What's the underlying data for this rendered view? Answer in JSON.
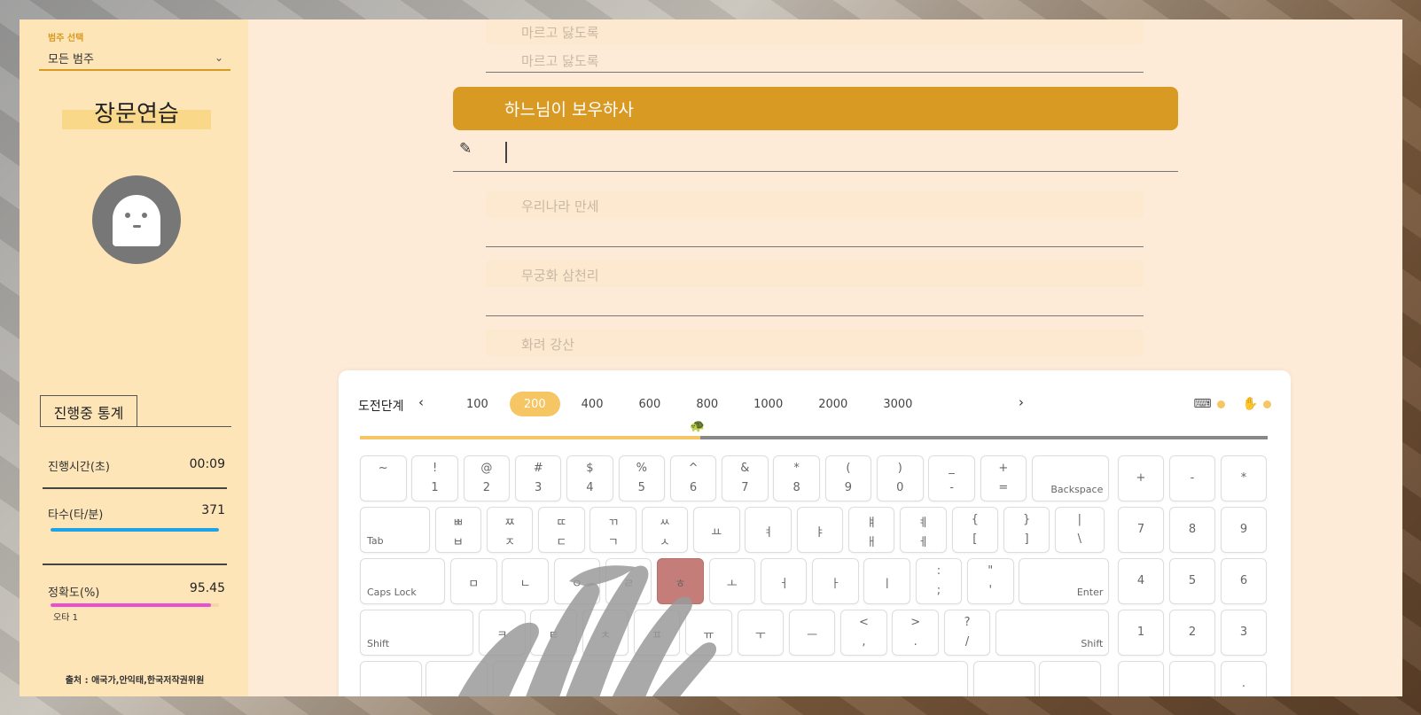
{
  "sidebar": {
    "category_label": "범주 선택",
    "category_value": "모든 범주",
    "mode_title": "장문연습",
    "stats_tab": "진행중 통계",
    "stats": {
      "time_label": "진행시간(초)",
      "time_value": "00:09",
      "speed_label": "타수(타/분)",
      "speed_value": "371",
      "accuracy_label": "정확도(%)",
      "accuracy_value": "95.45",
      "typo_label": "오타 1"
    },
    "source": "출처 : 애국가,안익태,한국저작권위원"
  },
  "colors": {
    "accent": "#d99a24",
    "level_active": "#f6c564",
    "speed_bar": "#1ea2e8",
    "accuracy_bar": "#e94fcf",
    "hit_key": "#c47d78"
  },
  "practice": {
    "prev_line_1": "마르고 닳도록",
    "prev_line_2": "마르고 닳도록",
    "current_line": "하느님이 보우하사",
    "input_value": "",
    "next_lines": [
      "우리나라 만세",
      "무궁화 삼천리",
      "화려 강산"
    ]
  },
  "keyboard_panel": {
    "level_label": "도전단계",
    "levels": [
      "100",
      "200",
      "400",
      "600",
      "800",
      "1000",
      "2000",
      "3000"
    ],
    "active_level": "200",
    "progress": 0.375,
    "icons": [
      "keyboard-icon",
      "hand-icon"
    ],
    "rows": [
      [
        {
          "t": "~",
          "b": ""
        },
        {
          "t": "!",
          "b": "1"
        },
        {
          "t": "@",
          "b": "2"
        },
        {
          "t": "#",
          "b": "3"
        },
        {
          "t": "$",
          "b": "4"
        },
        {
          "t": "%",
          "b": "5"
        },
        {
          "t": "^",
          "b": "6"
        },
        {
          "t": "&",
          "b": "7"
        },
        {
          "t": "*",
          "b": "8"
        },
        {
          "t": "(",
          "b": "9"
        },
        {
          "t": ")",
          "b": "0"
        },
        {
          "t": "_",
          "b": "-"
        },
        {
          "t": "+",
          "b": "="
        },
        {
          "label_r": "Backspace"
        }
      ],
      [
        {
          "label_l": "Tab"
        },
        {
          "t": "ㅃ",
          "b": "ㅂ"
        },
        {
          "t": "ㅉ",
          "b": "ㅈ"
        },
        {
          "t": "ㄸ",
          "b": "ㄷ"
        },
        {
          "t": "ㄲ",
          "b": "ㄱ"
        },
        {
          "t": "ㅆ",
          "b": "ㅅ"
        },
        {
          "m": "ㅛ"
        },
        {
          "m": "ㅕ"
        },
        {
          "m": "ㅑ"
        },
        {
          "t": "ㅒ",
          "b": "ㅐ"
        },
        {
          "t": "ㅖ",
          "b": "ㅔ"
        },
        {
          "t": "{",
          "b": "["
        },
        {
          "t": "}",
          "b": "]"
        },
        {
          "t": "|",
          "b": "\\"
        }
      ],
      [
        {
          "label_l": "Caps Lock"
        },
        {
          "m": "ㅁ"
        },
        {
          "m": "ㄴ"
        },
        {
          "m": "ㅇ"
        },
        {
          "m": "ㄹ"
        },
        {
          "m": "ㅎ"
        },
        {
          "m": "ㅗ"
        },
        {
          "m": "ㅓ"
        },
        {
          "m": "ㅏ"
        },
        {
          "m": "ㅣ"
        },
        {
          "t": ":",
          "b": ";"
        },
        {
          "t": "\"",
          "b": "'"
        },
        {
          "label_r": "Enter"
        }
      ],
      [
        {
          "label_l": "Shift"
        },
        {
          "m": "ㅋ"
        },
        {
          "m": "ㅌ"
        },
        {
          "m": "ㅊ"
        },
        {
          "m": "ㅍ"
        },
        {
          "m": "ㅠ"
        },
        {
          "m": "ㅜ"
        },
        {
          "m": "ㅡ"
        },
        {
          "t": "<",
          "b": ","
        },
        {
          "t": ">",
          "b": "."
        },
        {
          "t": "?",
          "b": "/"
        },
        {
          "label_r": "Shift"
        }
      ]
    ],
    "numpad": [
      [
        "+",
        "-",
        "*"
      ],
      [
        "7",
        "8",
        "9"
      ],
      [
        "4",
        "5",
        "6"
      ],
      [
        "1",
        "2",
        "3"
      ],
      [
        "",
        "",
        "."
      ]
    ],
    "highlighted_key": "ㅎ"
  }
}
